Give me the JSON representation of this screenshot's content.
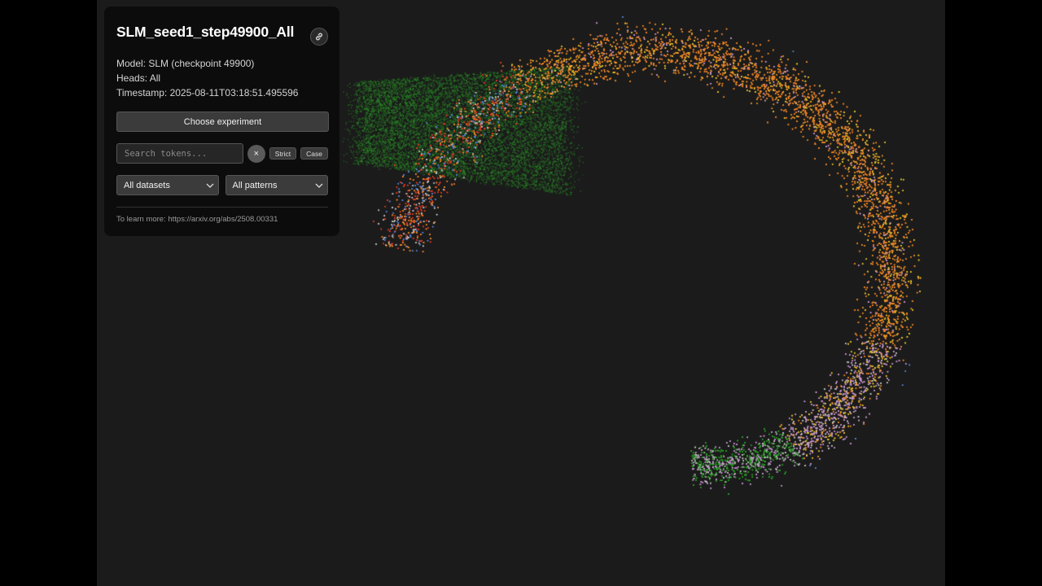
{
  "panel": {
    "title": "SLM_seed1_step49900_All",
    "model_line": "Model: SLM (checkpoint 49900)",
    "heads_line": "Heads: All",
    "timestamp_line": "Timestamp: 2025-08-11T03:18:51.495596",
    "choose_experiment_label": "Choose experiment",
    "search_placeholder": "Search tokens...",
    "search_value": "",
    "clear_label": "×",
    "strict_label": "Strict",
    "case_label": "Case",
    "dataset_select": "All datasets",
    "pattern_select": "All patterns",
    "learn_more_prefix": "To learn more: ",
    "learn_more_link": "https://arxiv.org/abs/2508.00331"
  },
  "colors": {
    "background": "#1b1b1b",
    "panel": "#0c0c0c",
    "point_palette": [
      "#2e9e2a",
      "#f08a2a",
      "#c79ad0",
      "#5a86d6",
      "#e8c830",
      "#e0402a",
      "#c8c8c8"
    ]
  }
}
